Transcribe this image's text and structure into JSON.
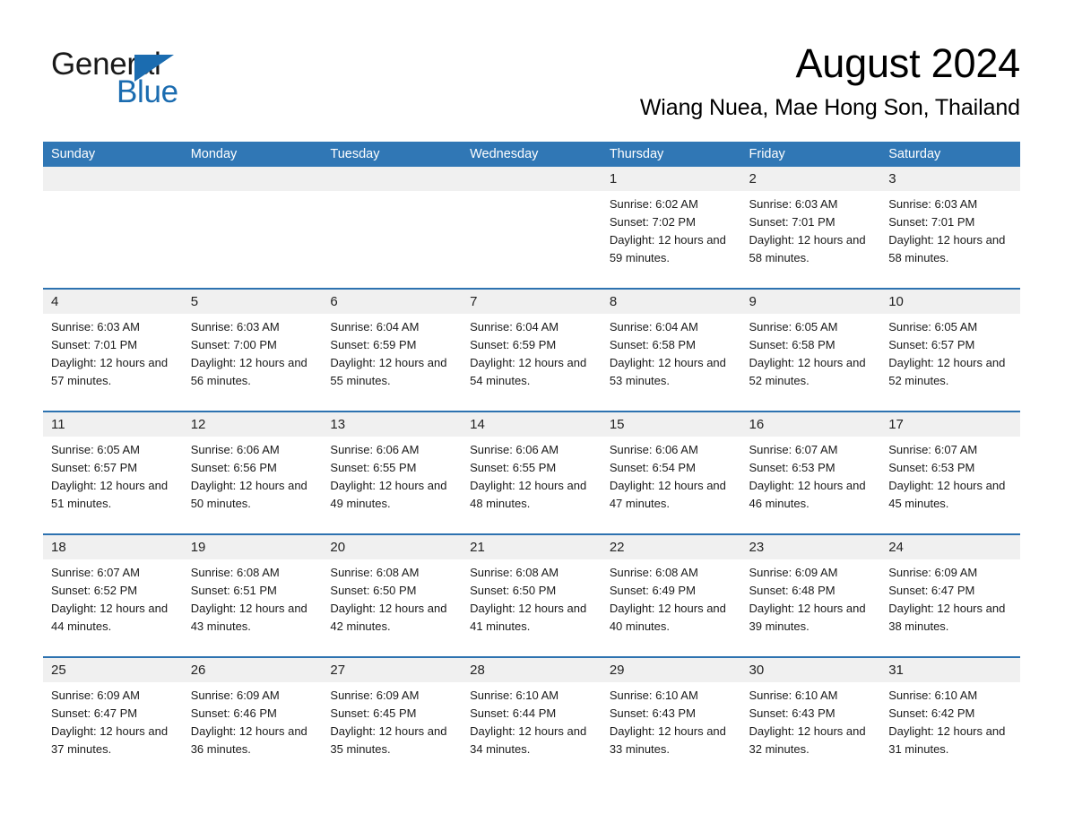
{
  "logo": {
    "word_dark": "General",
    "word_blue": "Blue",
    "accent_color": "#1b6cb0"
  },
  "header": {
    "month_title": "August 2024",
    "location": "Wiang Nuea, Mae Hong Son, Thailand",
    "header_bg_color": "#3077b5",
    "row_divider_color": "#2d72b0",
    "day_band_color": "#f0f0f0"
  },
  "calendar": {
    "weekdays": [
      "Sunday",
      "Monday",
      "Tuesday",
      "Wednesday",
      "Thursday",
      "Friday",
      "Saturday"
    ],
    "weeks": [
      [
        {
          "empty": true
        },
        {
          "empty": true
        },
        {
          "empty": true
        },
        {
          "empty": true
        },
        {
          "day": "1",
          "sunrise": "Sunrise: 6:02 AM",
          "sunset": "Sunset: 7:02 PM",
          "daylight": "Daylight: 12 hours and 59 minutes."
        },
        {
          "day": "2",
          "sunrise": "Sunrise: 6:03 AM",
          "sunset": "Sunset: 7:01 PM",
          "daylight": "Daylight: 12 hours and 58 minutes."
        },
        {
          "day": "3",
          "sunrise": "Sunrise: 6:03 AM",
          "sunset": "Sunset: 7:01 PM",
          "daylight": "Daylight: 12 hours and 58 minutes."
        }
      ],
      [
        {
          "day": "4",
          "sunrise": "Sunrise: 6:03 AM",
          "sunset": "Sunset: 7:01 PM",
          "daylight": "Daylight: 12 hours and 57 minutes."
        },
        {
          "day": "5",
          "sunrise": "Sunrise: 6:03 AM",
          "sunset": "Sunset: 7:00 PM",
          "daylight": "Daylight: 12 hours and 56 minutes."
        },
        {
          "day": "6",
          "sunrise": "Sunrise: 6:04 AM",
          "sunset": "Sunset: 6:59 PM",
          "daylight": "Daylight: 12 hours and 55 minutes."
        },
        {
          "day": "7",
          "sunrise": "Sunrise: 6:04 AM",
          "sunset": "Sunset: 6:59 PM",
          "daylight": "Daylight: 12 hours and 54 minutes."
        },
        {
          "day": "8",
          "sunrise": "Sunrise: 6:04 AM",
          "sunset": "Sunset: 6:58 PM",
          "daylight": "Daylight: 12 hours and 53 minutes."
        },
        {
          "day": "9",
          "sunrise": "Sunrise: 6:05 AM",
          "sunset": "Sunset: 6:58 PM",
          "daylight": "Daylight: 12 hours and 52 minutes."
        },
        {
          "day": "10",
          "sunrise": "Sunrise: 6:05 AM",
          "sunset": "Sunset: 6:57 PM",
          "daylight": "Daylight: 12 hours and 52 minutes."
        }
      ],
      [
        {
          "day": "11",
          "sunrise": "Sunrise: 6:05 AM",
          "sunset": "Sunset: 6:57 PM",
          "daylight": "Daylight: 12 hours and 51 minutes."
        },
        {
          "day": "12",
          "sunrise": "Sunrise: 6:06 AM",
          "sunset": "Sunset: 6:56 PM",
          "daylight": "Daylight: 12 hours and 50 minutes."
        },
        {
          "day": "13",
          "sunrise": "Sunrise: 6:06 AM",
          "sunset": "Sunset: 6:55 PM",
          "daylight": "Daylight: 12 hours and 49 minutes."
        },
        {
          "day": "14",
          "sunrise": "Sunrise: 6:06 AM",
          "sunset": "Sunset: 6:55 PM",
          "daylight": "Daylight: 12 hours and 48 minutes."
        },
        {
          "day": "15",
          "sunrise": "Sunrise: 6:06 AM",
          "sunset": "Sunset: 6:54 PM",
          "daylight": "Daylight: 12 hours and 47 minutes."
        },
        {
          "day": "16",
          "sunrise": "Sunrise: 6:07 AM",
          "sunset": "Sunset: 6:53 PM",
          "daylight": "Daylight: 12 hours and 46 minutes."
        },
        {
          "day": "17",
          "sunrise": "Sunrise: 6:07 AM",
          "sunset": "Sunset: 6:53 PM",
          "daylight": "Daylight: 12 hours and 45 minutes."
        }
      ],
      [
        {
          "day": "18",
          "sunrise": "Sunrise: 6:07 AM",
          "sunset": "Sunset: 6:52 PM",
          "daylight": "Daylight: 12 hours and 44 minutes."
        },
        {
          "day": "19",
          "sunrise": "Sunrise: 6:08 AM",
          "sunset": "Sunset: 6:51 PM",
          "daylight": "Daylight: 12 hours and 43 minutes."
        },
        {
          "day": "20",
          "sunrise": "Sunrise: 6:08 AM",
          "sunset": "Sunset: 6:50 PM",
          "daylight": "Daylight: 12 hours and 42 minutes."
        },
        {
          "day": "21",
          "sunrise": "Sunrise: 6:08 AM",
          "sunset": "Sunset: 6:50 PM",
          "daylight": "Daylight: 12 hours and 41 minutes."
        },
        {
          "day": "22",
          "sunrise": "Sunrise: 6:08 AM",
          "sunset": "Sunset: 6:49 PM",
          "daylight": "Daylight: 12 hours and 40 minutes."
        },
        {
          "day": "23",
          "sunrise": "Sunrise: 6:09 AM",
          "sunset": "Sunset: 6:48 PM",
          "daylight": "Daylight: 12 hours and 39 minutes."
        },
        {
          "day": "24",
          "sunrise": "Sunrise: 6:09 AM",
          "sunset": "Sunset: 6:47 PM",
          "daylight": "Daylight: 12 hours and 38 minutes."
        }
      ],
      [
        {
          "day": "25",
          "sunrise": "Sunrise: 6:09 AM",
          "sunset": "Sunset: 6:47 PM",
          "daylight": "Daylight: 12 hours and 37 minutes."
        },
        {
          "day": "26",
          "sunrise": "Sunrise: 6:09 AM",
          "sunset": "Sunset: 6:46 PM",
          "daylight": "Daylight: 12 hours and 36 minutes."
        },
        {
          "day": "27",
          "sunrise": "Sunrise: 6:09 AM",
          "sunset": "Sunset: 6:45 PM",
          "daylight": "Daylight: 12 hours and 35 minutes."
        },
        {
          "day": "28",
          "sunrise": "Sunrise: 6:10 AM",
          "sunset": "Sunset: 6:44 PM",
          "daylight": "Daylight: 12 hours and 34 minutes."
        },
        {
          "day": "29",
          "sunrise": "Sunrise: 6:10 AM",
          "sunset": "Sunset: 6:43 PM",
          "daylight": "Daylight: 12 hours and 33 minutes."
        },
        {
          "day": "30",
          "sunrise": "Sunrise: 6:10 AM",
          "sunset": "Sunset: 6:43 PM",
          "daylight": "Daylight: 12 hours and 32 minutes."
        },
        {
          "day": "31",
          "sunrise": "Sunrise: 6:10 AM",
          "sunset": "Sunset: 6:42 PM",
          "daylight": "Daylight: 12 hours and 31 minutes."
        }
      ]
    ]
  }
}
